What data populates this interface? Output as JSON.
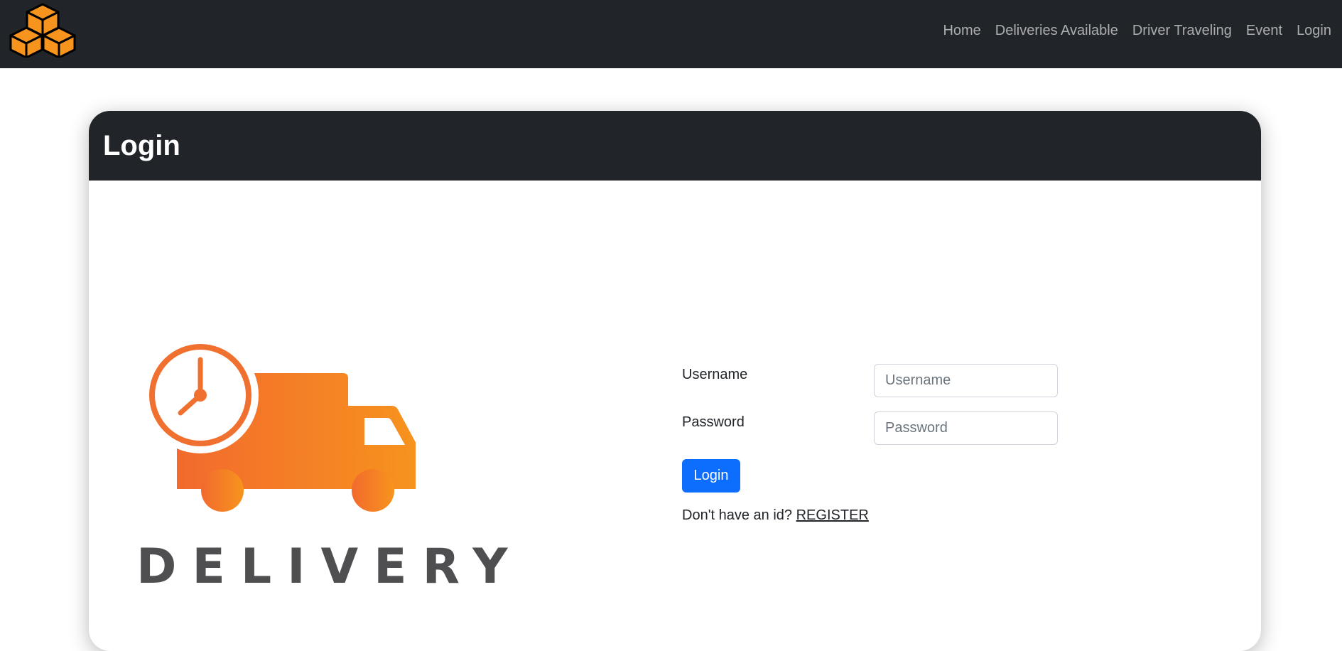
{
  "nav": {
    "links": [
      "Home",
      "Deliveries Available",
      "Driver Traveling",
      "Event",
      "Login"
    ]
  },
  "card": {
    "title": "Login"
  },
  "illustration": {
    "word": "DELIVERY"
  },
  "form": {
    "username_label": "Username",
    "username_placeholder": "Username",
    "password_label": "Password",
    "password_placeholder": "Password",
    "submit_label": "Login",
    "register_prompt": "Don't have an id?",
    "register_link": "REGISTER"
  },
  "colors": {
    "navbar": "#212529",
    "primary": "#0d6efd",
    "logo_orange": "#f7941d",
    "truck_gradient_start": "#f26a2e",
    "truck_gradient_end": "#f7941d"
  },
  "icons": {
    "logo": "boxes-icon",
    "illustration": "delivery-truck-clock-icon"
  }
}
